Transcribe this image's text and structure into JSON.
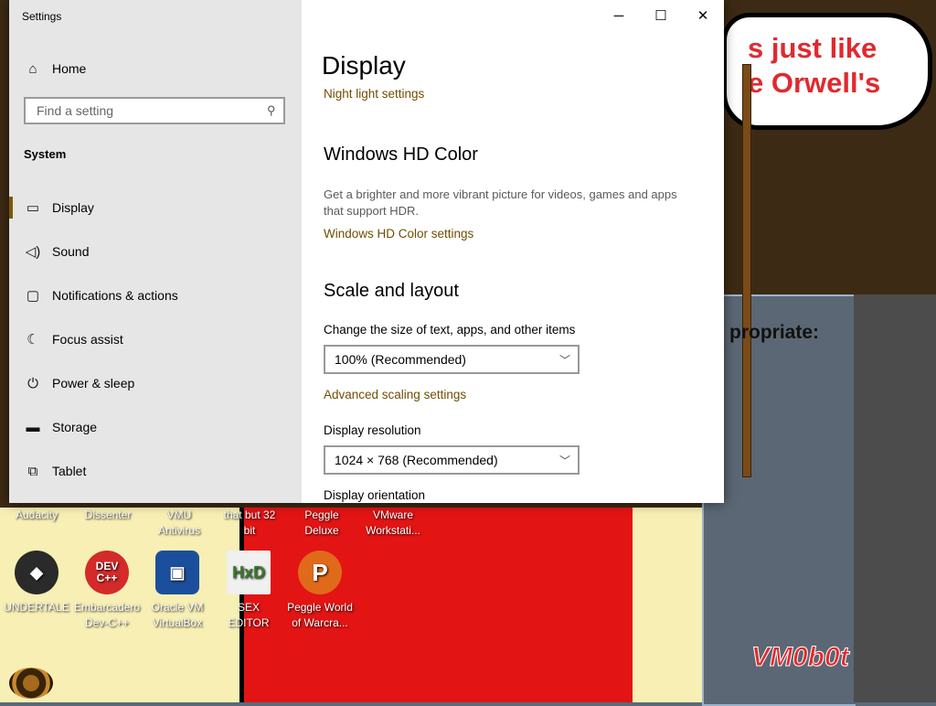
{
  "desktop": {
    "bubble_lines": [
      "s just like",
      "e Orwell's"
    ],
    "wall_note": "propriate:",
    "brand": "VM0b0t",
    "top_row_labels": [
      "Audacity",
      "Dissenter",
      "VMU\nAntivirus",
      "that but 32\nbit",
      "Peggle\nDeluxe",
      "VMware\nWorkstati..."
    ],
    "icons": [
      {
        "label": "UNDERTALE",
        "icon": "unity-icon",
        "color": "#222222",
        "glyph": "◆"
      },
      {
        "label": "Embarcadero\nDev-C++",
        "icon": "devcpp-icon",
        "color": "#d42a2a",
        "glyph": "DEV C++"
      },
      {
        "label": "Oracle VM\nVirtualBox",
        "icon": "virtualbox-icon",
        "color": "#1b4f9c",
        "glyph": "▣"
      },
      {
        "label": "SEX\nEDITOR",
        "icon": "hxd-icon",
        "color": "#f0f0f0",
        "glyph": "HxD"
      },
      {
        "label": "Peggle World\nof Warcra...",
        "icon": "peggle-icon",
        "color": "#e06a1a",
        "glyph": "P"
      }
    ]
  },
  "window": {
    "app_title": "Settings",
    "controls": {
      "minimize": "─",
      "maximize": "☐",
      "close": "✕"
    },
    "sidebar": {
      "home_label": "Home",
      "search_placeholder": "Find a setting",
      "section": "System",
      "items": [
        {
          "label": "Display",
          "icon": "monitor-icon",
          "glyph": "▭",
          "active": true
        },
        {
          "label": "Sound",
          "icon": "speaker-icon",
          "glyph": "🔈︎",
          "active": false
        },
        {
          "label": "Notifications & actions",
          "icon": "notification-icon",
          "glyph": "▢",
          "active": false
        },
        {
          "label": "Focus assist",
          "icon": "moon-icon",
          "glyph": "☾",
          "active": false
        },
        {
          "label": "Power & sleep",
          "icon": "power-icon",
          "glyph": "⏻",
          "active": false
        },
        {
          "label": "Storage",
          "icon": "storage-icon",
          "glyph": "▬",
          "active": false
        },
        {
          "label": "Tablet",
          "icon": "tablet-icon",
          "glyph": "⧉",
          "active": false
        }
      ]
    },
    "main": {
      "title": "Display",
      "night_light_link": "Night light settings",
      "hd_color": {
        "heading": "Windows HD Color",
        "description": "Get a brighter and more vibrant picture for videos, games and apps that support HDR.",
        "link": "Windows HD Color settings"
      },
      "scale_layout": {
        "heading": "Scale and layout",
        "scale_label": "Change the size of text, apps, and other items",
        "scale_value": "100% (Recommended)",
        "advanced_link": "Advanced scaling settings",
        "resolution_label": "Display resolution",
        "resolution_value": "1024 × 768 (Recommended)",
        "orientation_label": "Display orientation"
      }
    }
  },
  "colors": {
    "accent_link": "#6f4e00",
    "sidebar_bg": "#e6e6e6"
  }
}
